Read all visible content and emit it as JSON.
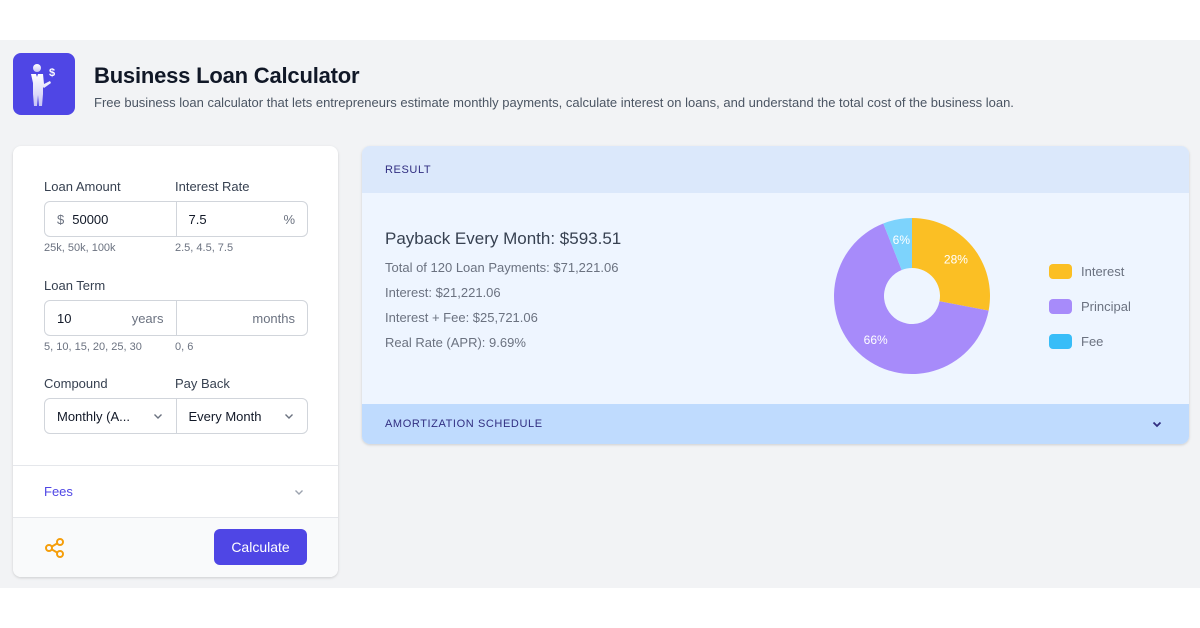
{
  "header": {
    "title": "Business Loan Calculator",
    "subtitle": "Free business loan calculator that lets entrepreneurs estimate monthly payments, calculate interest on loans, and understand the total cost of the business loan.",
    "logo_icon": "businessman-dollar-icon"
  },
  "form": {
    "loan_amount": {
      "label": "Loan Amount",
      "prefix": "$",
      "value": "50000",
      "hint": "25k, 50k, 100k"
    },
    "interest_rate": {
      "label": "Interest Rate",
      "value": "7.5",
      "suffix": "%",
      "hint": "2.5, 4.5, 7.5"
    },
    "loan_term": {
      "label": "Loan Term",
      "years_value": "10",
      "years_suffix": "years",
      "years_hint": "5, 10, 15, 20, 25, 30",
      "months_value": "",
      "months_suffix": "months",
      "months_hint": "0, 6"
    },
    "compound": {
      "label": "Compound",
      "selected": "Monthly (A..."
    },
    "pay_back": {
      "label": "Pay Back",
      "selected": "Every Month"
    },
    "fees": {
      "label": "Fees"
    },
    "calculate_label": "Calculate",
    "share_icon": "share-icon"
  },
  "result": {
    "header": "RESULT",
    "payback": "Payback Every Month: $593.51",
    "total_payments": "Total of 120 Loan Payments: $71,221.06",
    "interest": "Interest: $21,221.06",
    "interest_fee": "Interest + Fee: $25,721.06",
    "apr": "Real Rate (APR): 9.69%",
    "amortization_label": "AMORTIZATION SCHEDULE"
  },
  "colors": {
    "accent": "#4f46e5",
    "interest": "#fbbf24",
    "principal": "#a78bfa",
    "fee": "#38bdf8",
    "share": "#f59e0b"
  },
  "chart_data": {
    "type": "pie",
    "donut": true,
    "title": "",
    "categories": [
      "Interest",
      "Principal",
      "Fee"
    ],
    "values": [
      28,
      66,
      6
    ],
    "labels": [
      "28%",
      "66%",
      "6%"
    ],
    "colors": [
      "#fbbf24",
      "#a78bfa",
      "#7dd3fc"
    ],
    "legend_colors": [
      "#fbbf24",
      "#a78bfa",
      "#38bdf8"
    ],
    "legend_position": "right"
  }
}
